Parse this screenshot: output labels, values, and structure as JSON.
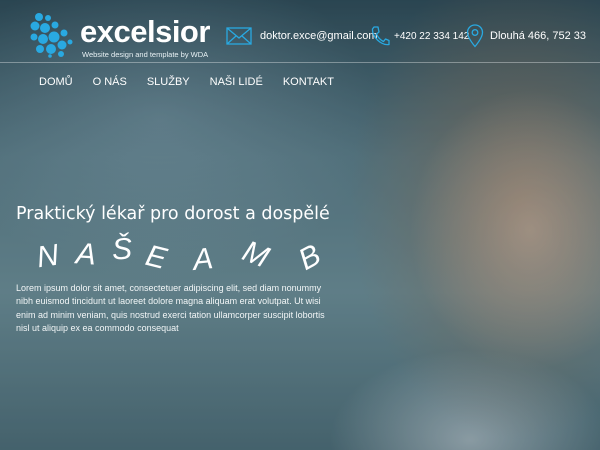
{
  "brand": {
    "name": "excelsior",
    "tagline": "Website design and template by WDA",
    "accent": "#29a9e1"
  },
  "contacts": {
    "email": "doktor.exce@gmail.com",
    "phone": "+420 22 334 142",
    "address": "Dlouhá 466, 752 33",
    "icons": [
      "envelope-icon",
      "phone-icon",
      "map-pin-icon"
    ]
  },
  "nav": {
    "items": [
      {
        "label": "DOMŮ"
      },
      {
        "label": "O NÁS"
      },
      {
        "label": "SLUŽBY"
      },
      {
        "label": "NAŠI LIDÉ"
      },
      {
        "label": "KONTAKT"
      }
    ]
  },
  "hero": {
    "title": "Praktický lékař pro dorost a dospělé",
    "animated_letters": [
      "N",
      "A",
      "Š",
      "E",
      "A",
      "M",
      "B"
    ],
    "text": "Lorem ipsum dolor sit amet, consectetuer adipiscing elit, sed diam nonummy nibh euismod tincidunt ut laoreet dolore magna aliquam erat volutpat. Ut wisi enim ad minim veniam, quis nostrud exerci tation ullamcorper suscipit lobortis nisl ut aliquip ex ea commodo consequat"
  }
}
